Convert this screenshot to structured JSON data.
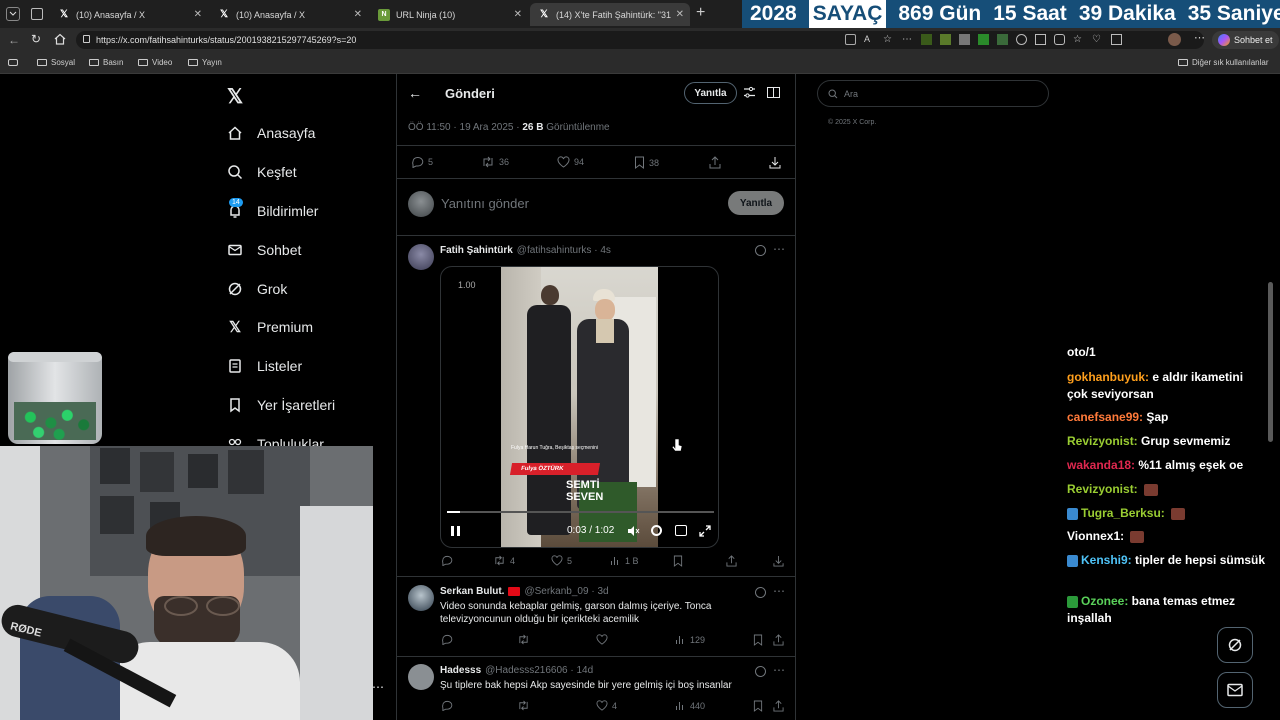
{
  "tabs": [
    {
      "title": "(10) Anasayfa / X",
      "icon": "x-logo-icon"
    },
    {
      "title": "(10) Anasayfa / X",
      "icon": "x-logo-icon"
    },
    {
      "title": "URL Ninja (10)",
      "icon": "url-ninja-icon"
    },
    {
      "title": "(14) X'te Fatih Şahintürk: \"31 …",
      "icon": "x-logo-icon"
    }
  ],
  "counter": {
    "year": "2028",
    "label": "SAYAÇ",
    "days": "869 Gün",
    "hours": "15 Saat",
    "minutes": "39 Dakika",
    "seconds": "35 Saniye"
  },
  "url": "https://x.com/fatihsahinturks/status/2001938215297745269?s=20",
  "copilot_label": "Sohbet et",
  "bookmarks": [
    "Sosyal",
    "Basın",
    "Video",
    "Yayın"
  ],
  "other_bookmarks": "Diğer sık kullanılanlar",
  "nav": [
    {
      "label": "Anasayfa",
      "icon": "home-icon"
    },
    {
      "label": "Keşfet",
      "icon": "search-icon"
    },
    {
      "label": "Bildirimler",
      "icon": "bell-icon",
      "badge": "14"
    },
    {
      "label": "Sohbet",
      "icon": "mail-icon"
    },
    {
      "label": "Grok",
      "icon": "grok-icon"
    },
    {
      "label": "Premium",
      "icon": "x-logo-icon"
    },
    {
      "label": "Listeler",
      "icon": "list-icon"
    },
    {
      "label": "Yer İşaretleri",
      "icon": "bookmark-icon"
    },
    {
      "label": "Topluluklar",
      "icon": "communities-icon"
    }
  ],
  "header": {
    "title": "Gönderi",
    "reply_button": "Yanıtla"
  },
  "post_meta": {
    "time": "ÖÖ 11:50 · 19 Ara 2025 · ",
    "views": "26 B",
    "views_label": " Görüntülenme"
  },
  "post_actions": {
    "replies": "5",
    "reposts": "36",
    "likes": "94",
    "bookmarks": "38"
  },
  "compose": {
    "placeholder": "Yanıtını gönder",
    "button": "Yanıtla"
  },
  "reply1": {
    "name": "Fatih Şahintürk",
    "handle": "@fatihsahinturks · 4s",
    "video": {
      "speed": "1.00",
      "time": "0:03 / 1:02",
      "caption1": "Fulya Harun Tuğra, Beşiktaş seçmenini",
      "caption2": "Fulya ÖZTÜRK",
      "brand1": "SEMTİ",
      "brand2": "SEVEN",
      "progress": 0.05
    },
    "actions": {
      "replies": "",
      "reposts": "4",
      "likes": "5",
      "views": "1 B"
    }
  },
  "reply2": {
    "name": "Serkan Bulut.",
    "handle": "@Serkanb_09 · 3d",
    "text": "Video sonunda kebaplar gelmiş, garson dalmış içeriye. Tonca televizyoncunun olduğu bir içerikteki acemilik",
    "actions": {
      "views": "129"
    }
  },
  "reply3": {
    "name": "Hadesss",
    "handle": "@Hadesss216606 · 14d",
    "text": "Şu tiplere bak hepsi Akp sayesinde bir yere gelmiş içi boş insanlar",
    "actions": {
      "likes": "4",
      "views": "440"
    }
  },
  "search": {
    "placeholder": "Ara"
  },
  "footer": {
    "copyright": "© 2025 X Corp."
  },
  "chat": [
    {
      "user": "",
      "text": "oto/1",
      "color": "#ffffff"
    },
    {
      "user": "gokhanbuyuk:",
      "text": " e aldır ikametini çok seviyorsan",
      "color": "#ff9f1c"
    },
    {
      "user": "canefsane99:",
      "text": " Şap",
      "color": "#ff7a3a"
    },
    {
      "user": "Revizyonist:",
      "text": " Grup sevmemiz",
      "color": "#9acd32"
    },
    {
      "user": "wakanda18:",
      "text": " %11 almış eşek oe",
      "color": "#e0284f"
    },
    {
      "user": "Revizyonist:",
      "text": "",
      "color": "#9acd32"
    },
    {
      "user": "Tugra_Berksu:",
      "text": "",
      "color": "#9acd32"
    },
    {
      "user": "Vionnex1:",
      "text": "",
      "color": "#ffffff"
    },
    {
      "user": "Kenshi9:",
      "text": " tipler de hepsi sümsük",
      "color": "#4fc3f7"
    },
    {
      "user": "Ozonee:",
      "text": " bana temas etmez inşallah",
      "color": "#5ad15a"
    }
  ],
  "colors": {
    "accent": "#1d9bf0",
    "counter_bg": "#164e78",
    "background": "#000000"
  }
}
